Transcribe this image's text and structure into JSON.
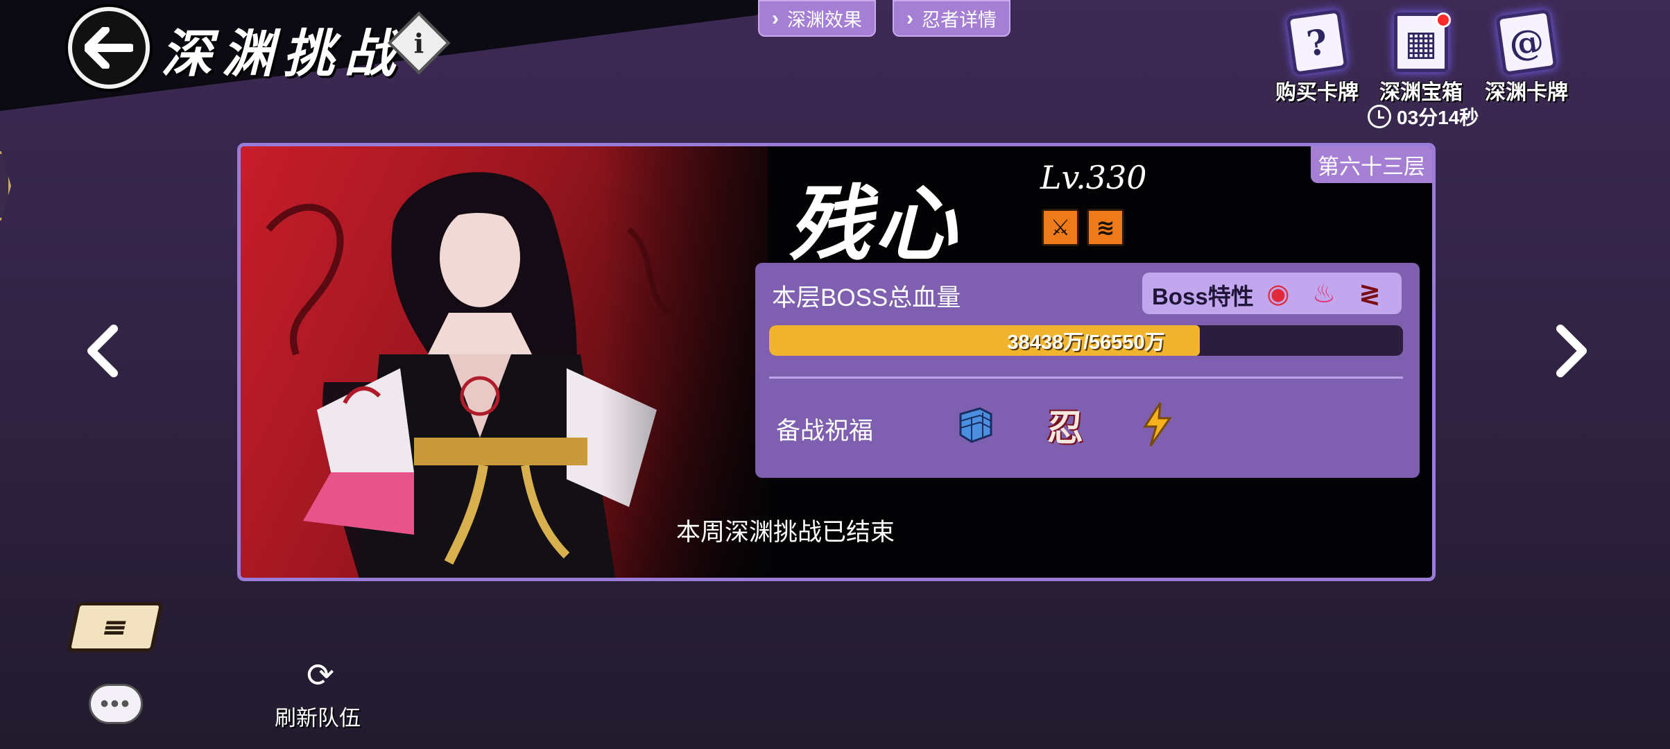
{
  "header": {
    "title": "深渊挑战",
    "info_glyph": "i",
    "back_icon": "back-arrow-icon"
  },
  "tabs": [
    {
      "label": "深渊效果"
    },
    {
      "label": "忍者详情"
    }
  ],
  "top_icons": [
    {
      "label": "购买卡牌",
      "icon": "card-question-icon"
    },
    {
      "label": "深渊宝箱",
      "icon": "gift-box-icon",
      "has_red_dot": true
    },
    {
      "label": "深渊卡牌",
      "icon": "swirl-card-icon"
    }
  ],
  "timer": {
    "text": "03分14秒"
  },
  "boss": {
    "floor": "第六十三层",
    "name": "残心",
    "level": "Lv.330",
    "hp_label": "本层BOSS总血量",
    "hp_current": 38438,
    "hp_max": 56550,
    "hp_text": "38438万/56550万",
    "trait_label": "Boss特性",
    "traits": [
      "eye-icon",
      "flame-icon",
      "claw-icon"
    ],
    "blessing_label": "备战祝福",
    "blessings": [
      "brick-wall-icon",
      "ninja-glyph-icon",
      "lightning-icon"
    ],
    "status": "本周深渊挑战已结束"
  },
  "bottom": {
    "refresh_label": "刷新队伍"
  },
  "colors": {
    "accent_purple": "#a57fd4",
    "hp_yellow": "#f0b42e",
    "panel_purple": "#7e5fb0",
    "attr_orange": "#ee7a1a"
  }
}
